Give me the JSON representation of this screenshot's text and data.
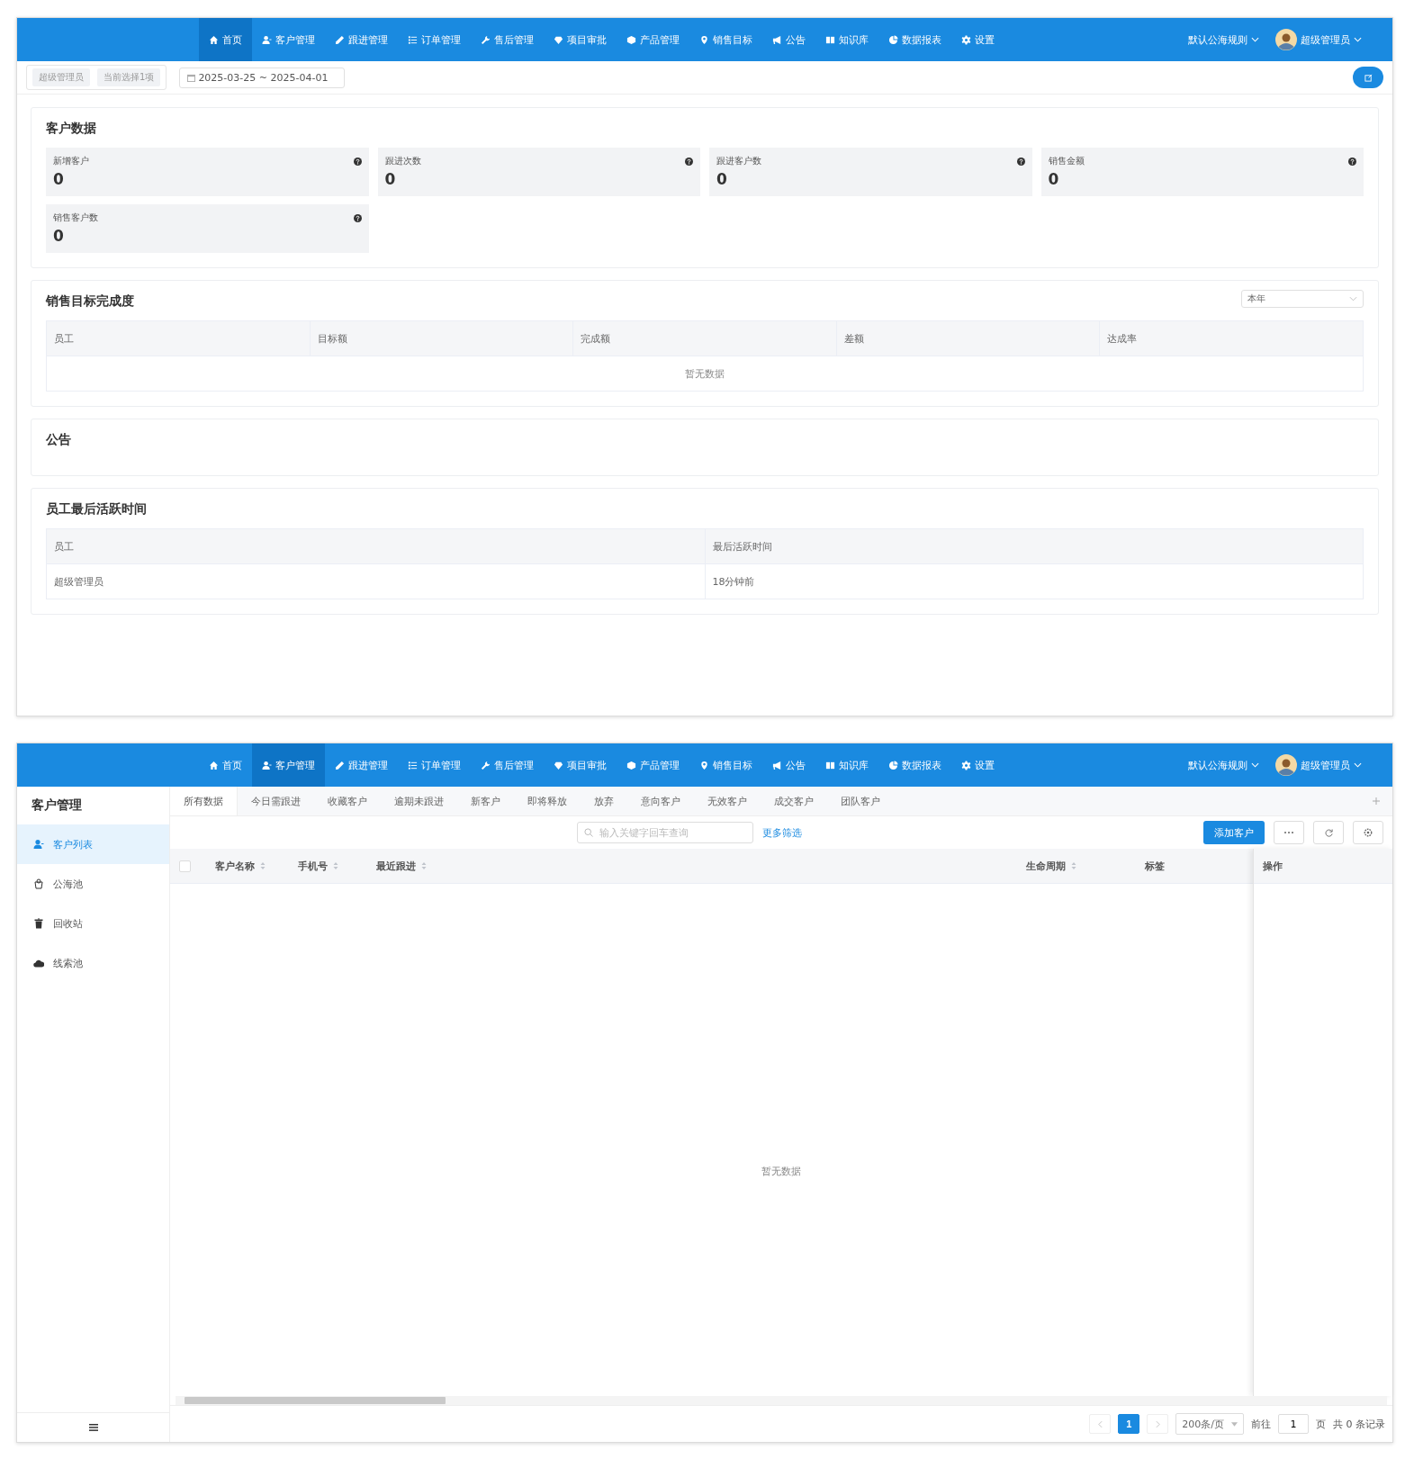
{
  "dashboard_window": {
    "nav": {
      "items": [
        {
          "label": "首页",
          "selected": true
        },
        {
          "label": "客户管理",
          "selected": false
        },
        {
          "label": "跟进管理",
          "selected": false
        },
        {
          "label": "订单管理",
          "selected": false
        },
        {
          "label": "售后管理",
          "selected": false
        },
        {
          "label": "项目审批",
          "selected": false
        },
        {
          "label": "产品管理",
          "selected": false
        },
        {
          "label": "销售目标",
          "selected": false
        },
        {
          "label": "公告",
          "selected": false
        },
        {
          "label": "知识库",
          "selected": false
        },
        {
          "label": "数据报表",
          "selected": false
        },
        {
          "label": "设置",
          "selected": false
        }
      ],
      "rule_menu": "默认公海规则",
      "user": "超级管理员"
    },
    "filter_bar": {
      "tags": [
        "超级管理员",
        "当前选择1项"
      ],
      "date_range": "2025-03-25 ~ 2025-04-01"
    },
    "customer_data": {
      "title": "客户数据",
      "stats": [
        {
          "label": "新增客户",
          "value": "0"
        },
        {
          "label": "跟进次数",
          "value": "0"
        },
        {
          "label": "跟进客户数",
          "value": "0"
        },
        {
          "label": "销售金额",
          "value": "0"
        },
        {
          "label": "销售客户数",
          "value": "0"
        }
      ]
    },
    "sales_target": {
      "title": "销售目标完成度",
      "period_select": "本年",
      "columns": [
        "员工",
        "目标额",
        "完成额",
        "差额",
        "达成率"
      ],
      "empty_text": "暂无数据"
    },
    "announcements": {
      "title": "公告"
    },
    "last_active": {
      "title": "员工最后活跃时间",
      "columns": [
        "员工",
        "最后活跃时间"
      ],
      "rows": [
        [
          "超级管理员",
          "18分钟前"
        ]
      ]
    }
  },
  "customer_window": {
    "nav": {
      "items": [
        {
          "label": "首页",
          "selected": false
        },
        {
          "label": "客户管理",
          "selected": true
        },
        {
          "label": "跟进管理",
          "selected": false
        },
        {
          "label": "订单管理",
          "selected": false
        },
        {
          "label": "售后管理",
          "selected": false
        },
        {
          "label": "项目审批",
          "selected": false
        },
        {
          "label": "产品管理",
          "selected": false
        },
        {
          "label": "销售目标",
          "selected": false
        },
        {
          "label": "公告",
          "selected": false
        },
        {
          "label": "知识库",
          "selected": false
        },
        {
          "label": "数据报表",
          "selected": false
        },
        {
          "label": "设置",
          "selected": false
        }
      ],
      "rule_menu": "默认公海规则",
      "user": "超级管理员"
    },
    "sidebar": {
      "title": "客户管理",
      "items": [
        {
          "label": "客户列表",
          "selected": true
        },
        {
          "label": "公海池",
          "selected": false
        },
        {
          "label": "回收站",
          "selected": false
        },
        {
          "label": "线索池",
          "selected": false
        }
      ]
    },
    "tabs": [
      {
        "label": "所有数据",
        "selected": true
      },
      {
        "label": "今日需跟进",
        "selected": false
      },
      {
        "label": "收藏客户",
        "selected": false
      },
      {
        "label": "逾期未跟进",
        "selected": false
      },
      {
        "label": "新客户",
        "selected": false
      },
      {
        "label": "即将释放",
        "selected": false
      },
      {
        "label": "放弃",
        "selected": false
      },
      {
        "label": "意向客户",
        "selected": false
      },
      {
        "label": "无效客户",
        "selected": false
      },
      {
        "label": "成交客户",
        "selected": false
      },
      {
        "label": "团队客户",
        "selected": false
      }
    ],
    "search": {
      "placeholder": "输入关键字回车查询"
    },
    "more_filters": "更多筛选",
    "add_button": "添加客户",
    "select_all": {
      "checked": false
    },
    "columns": [
      {
        "label": "客户名称",
        "sortable": true
      },
      {
        "label": "手机号",
        "sortable": true
      },
      {
        "label": "最近跟进",
        "sortable": true
      },
      {
        "label": "生命周期",
        "sortable": true
      },
      {
        "label": "标签",
        "sortable": false
      },
      {
        "label": "操作",
        "sortable": false
      }
    ],
    "empty_text": "暂无数据",
    "pagination": {
      "page": "1",
      "page_size": "200条/页",
      "goto_label": "前往",
      "goto_value": "1",
      "page_unit": "页",
      "total": "共 0 条记录"
    }
  }
}
